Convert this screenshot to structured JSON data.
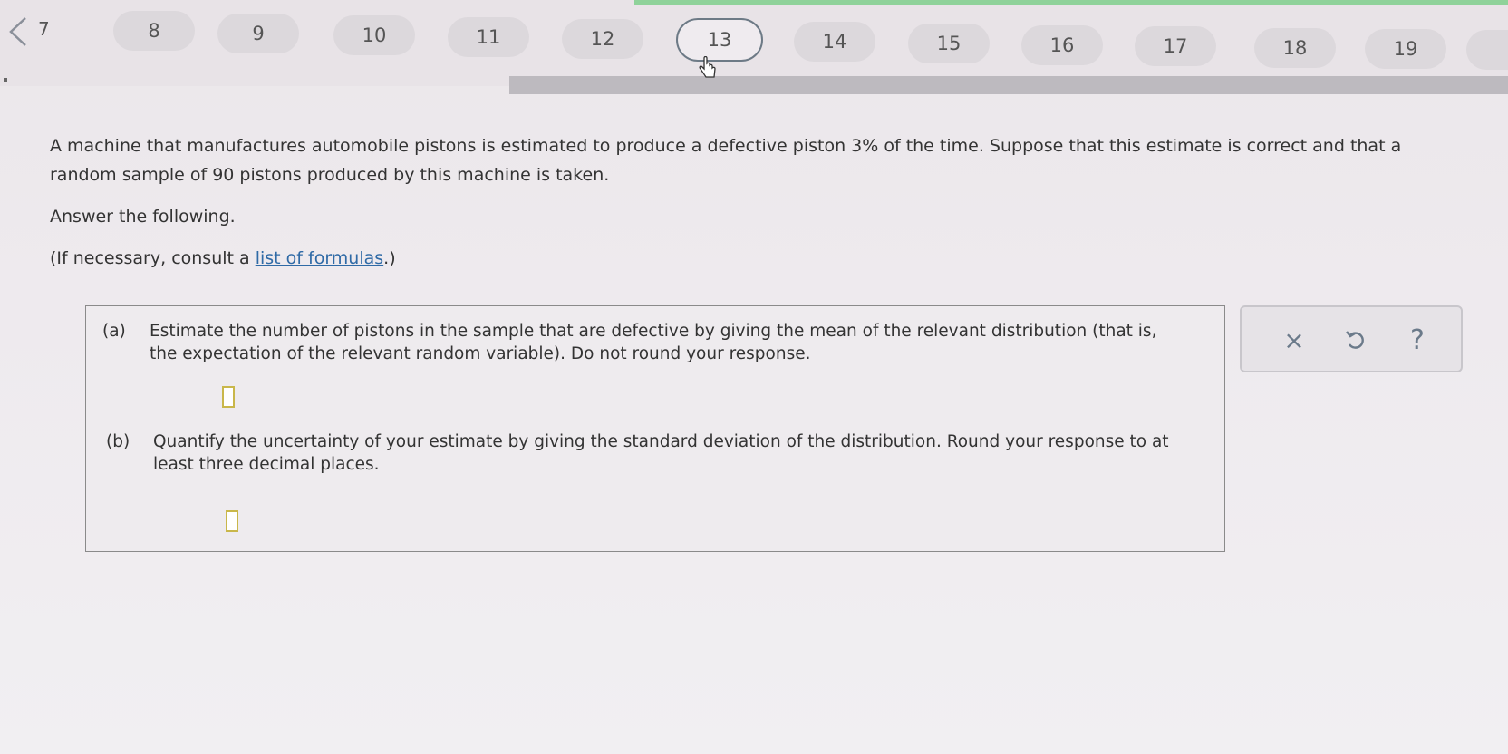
{
  "nav": {
    "first_label": "7",
    "pills": [
      "8",
      "9",
      "10",
      "11",
      "12",
      "13",
      "14",
      "15",
      "16",
      "17",
      "18",
      "19"
    ],
    "active": "13"
  },
  "problem": {
    "intro": "A machine that manufactures automobile pistons is estimated to produce a defective piston 3% of the time. Suppose that this estimate is correct and that a random sample of 90 pistons produced by this machine is taken.",
    "instruction": "Answer the following.",
    "formula_prefix": "(If necessary, consult a ",
    "formula_link": "list of formulas",
    "formula_suffix": ".)"
  },
  "parts": {
    "a": {
      "label": "(a)",
      "text": "Estimate the number of pistons in the sample that are defective by giving the mean of the relevant distribution (that is, the expectation of the relevant random variable). Do not round your response."
    },
    "b": {
      "label": "(b)",
      "text": "Quantify the uncertainty of your estimate by giving the standard deviation of the distribution. Round your response to at least three decimal places."
    }
  },
  "tools": {
    "clear_icon": "close-icon",
    "clear_symbol": "×",
    "undo_icon": "undo-icon",
    "help_icon": "help-icon",
    "help_symbol": "?"
  },
  "colors": {
    "link": "#2f6aa6",
    "input_border": "#c9b74a",
    "active_pill_border": "#6d7a86",
    "top_strip": "#8fd29a"
  }
}
